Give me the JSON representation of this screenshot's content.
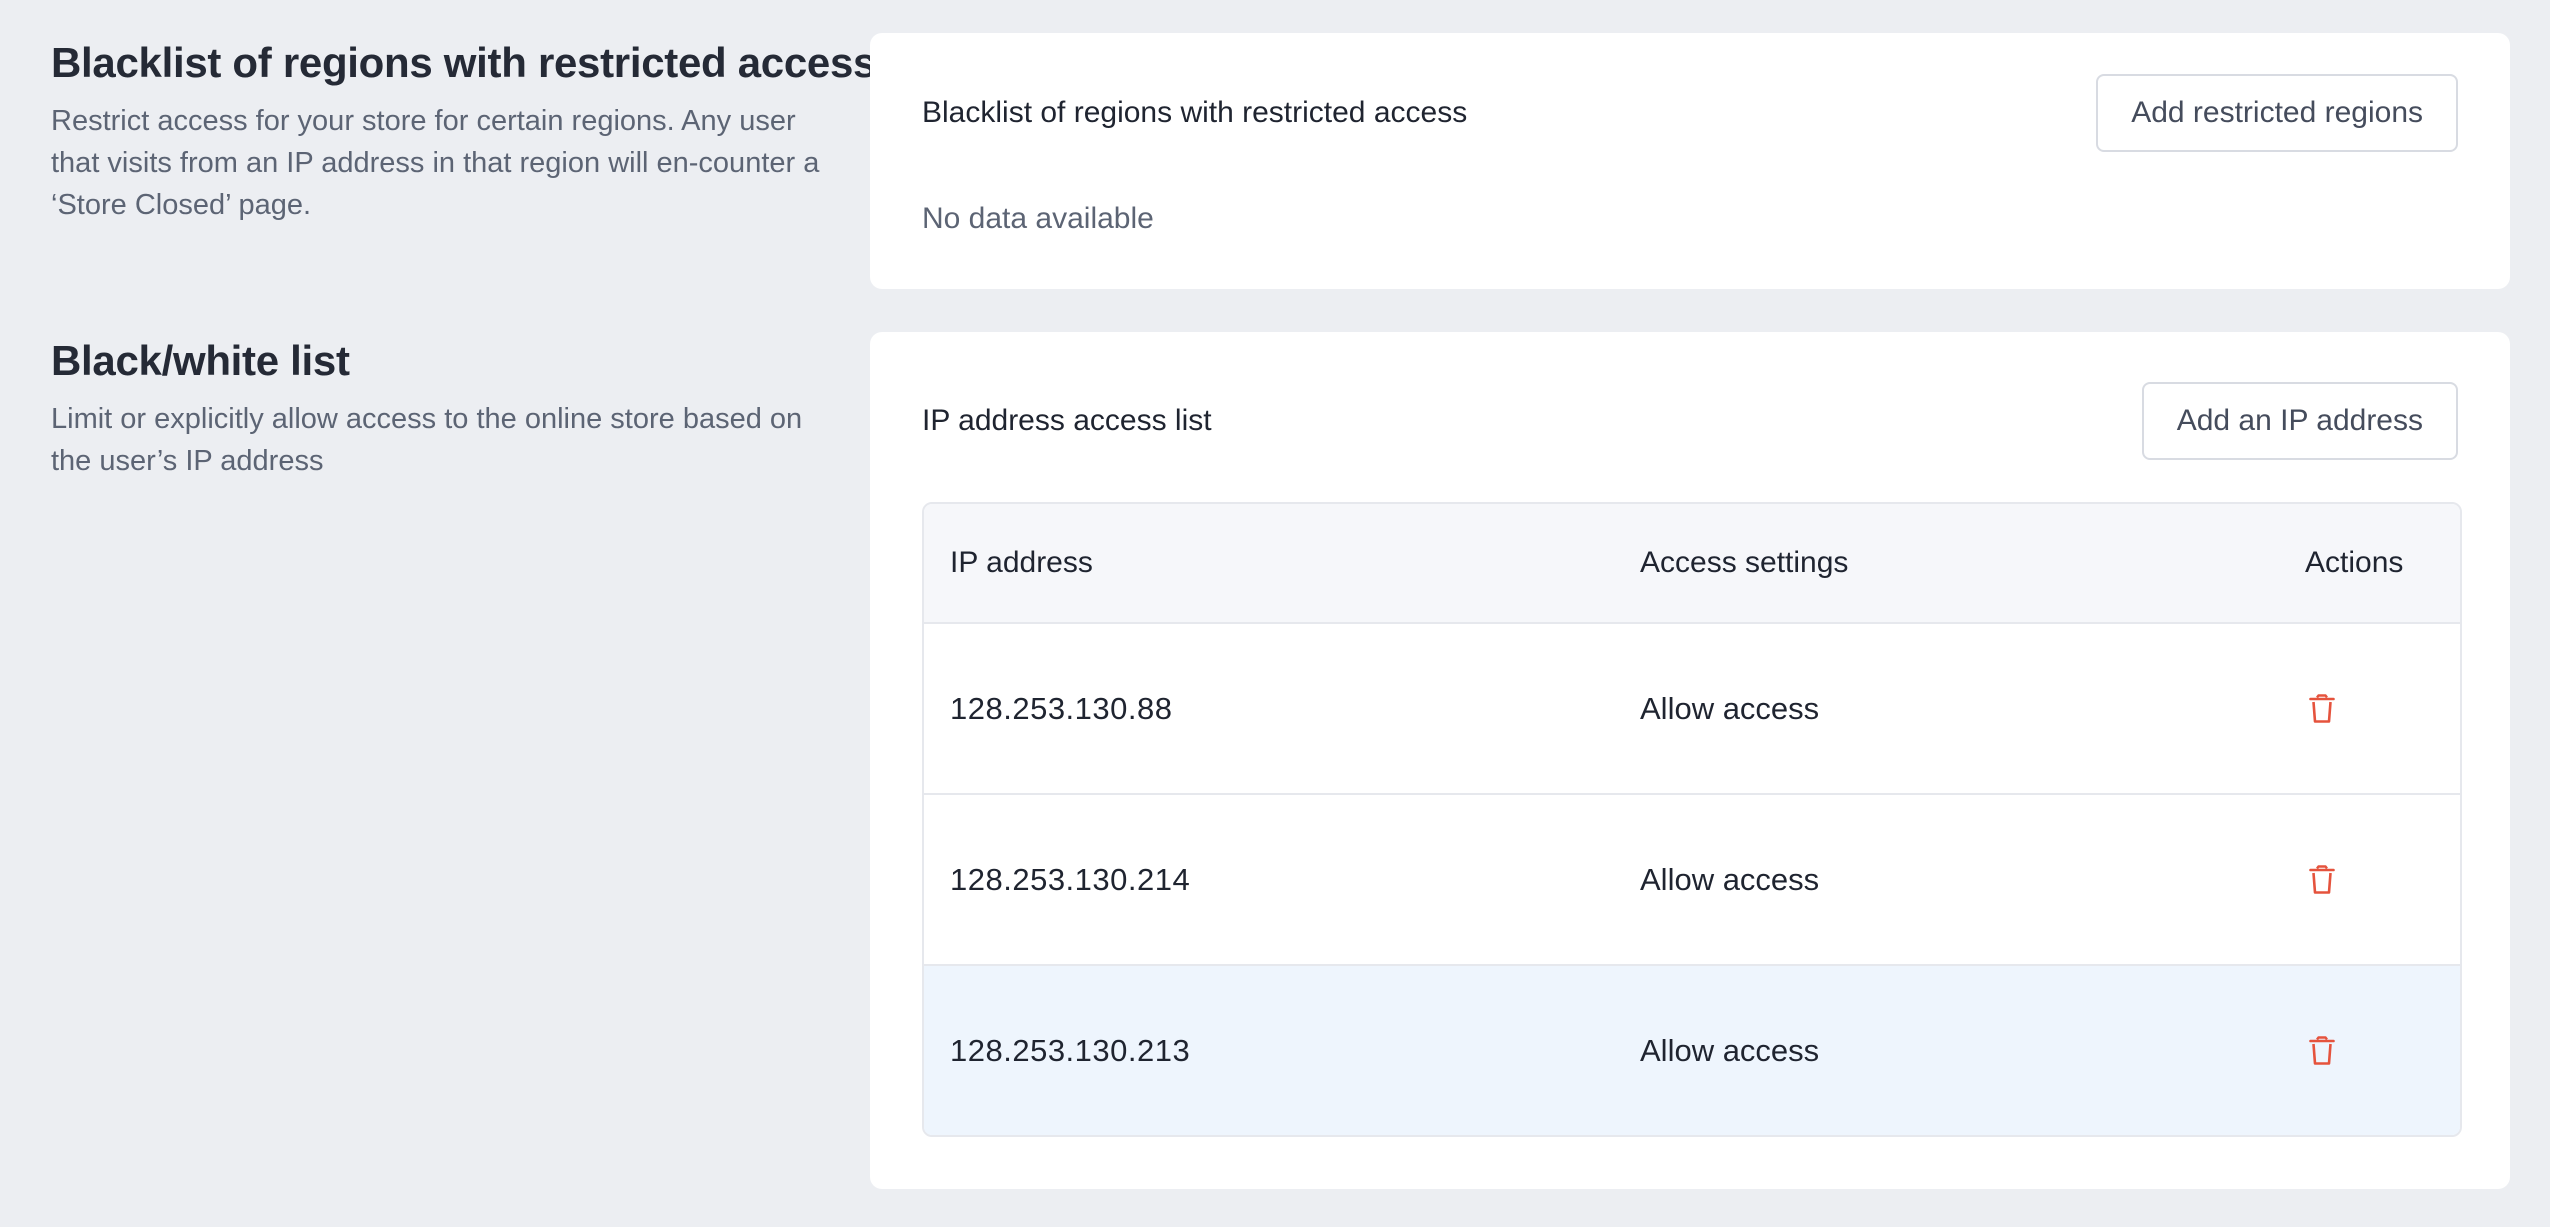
{
  "regions_section": {
    "title": "Blacklist of regions with restricted access",
    "description": "Restrict access for your store for certain regions. Any user that visits from an IP address in that region will en-counter a ‘Store Closed’ page.",
    "card_title": "Blacklist of regions with restricted access",
    "add_button": "Add restricted regions",
    "empty_text": "No data available"
  },
  "ip_section": {
    "title": "Black/white list",
    "description": "Limit or explicitly allow access to the online store based on the user’s IP address",
    "card_title": "IP address access list",
    "add_button": "Add an IP address",
    "table": {
      "columns": [
        "IP address",
        "Access settings",
        "Actions"
      ],
      "rows": [
        {
          "ip": "128.253.130.88",
          "access": "Allow access",
          "action_icon": "trash-icon"
        },
        {
          "ip": "128.253.130.214",
          "access": "Allow access",
          "action_icon": "trash-icon"
        },
        {
          "ip": "128.253.130.213",
          "access": "Allow access",
          "action_icon": "trash-icon"
        }
      ]
    }
  },
  "colors": {
    "page_background": "#eceef2",
    "card_background": "#ffffff",
    "delete_icon": "#e5533d",
    "row_highlight": "#eef5fd"
  }
}
